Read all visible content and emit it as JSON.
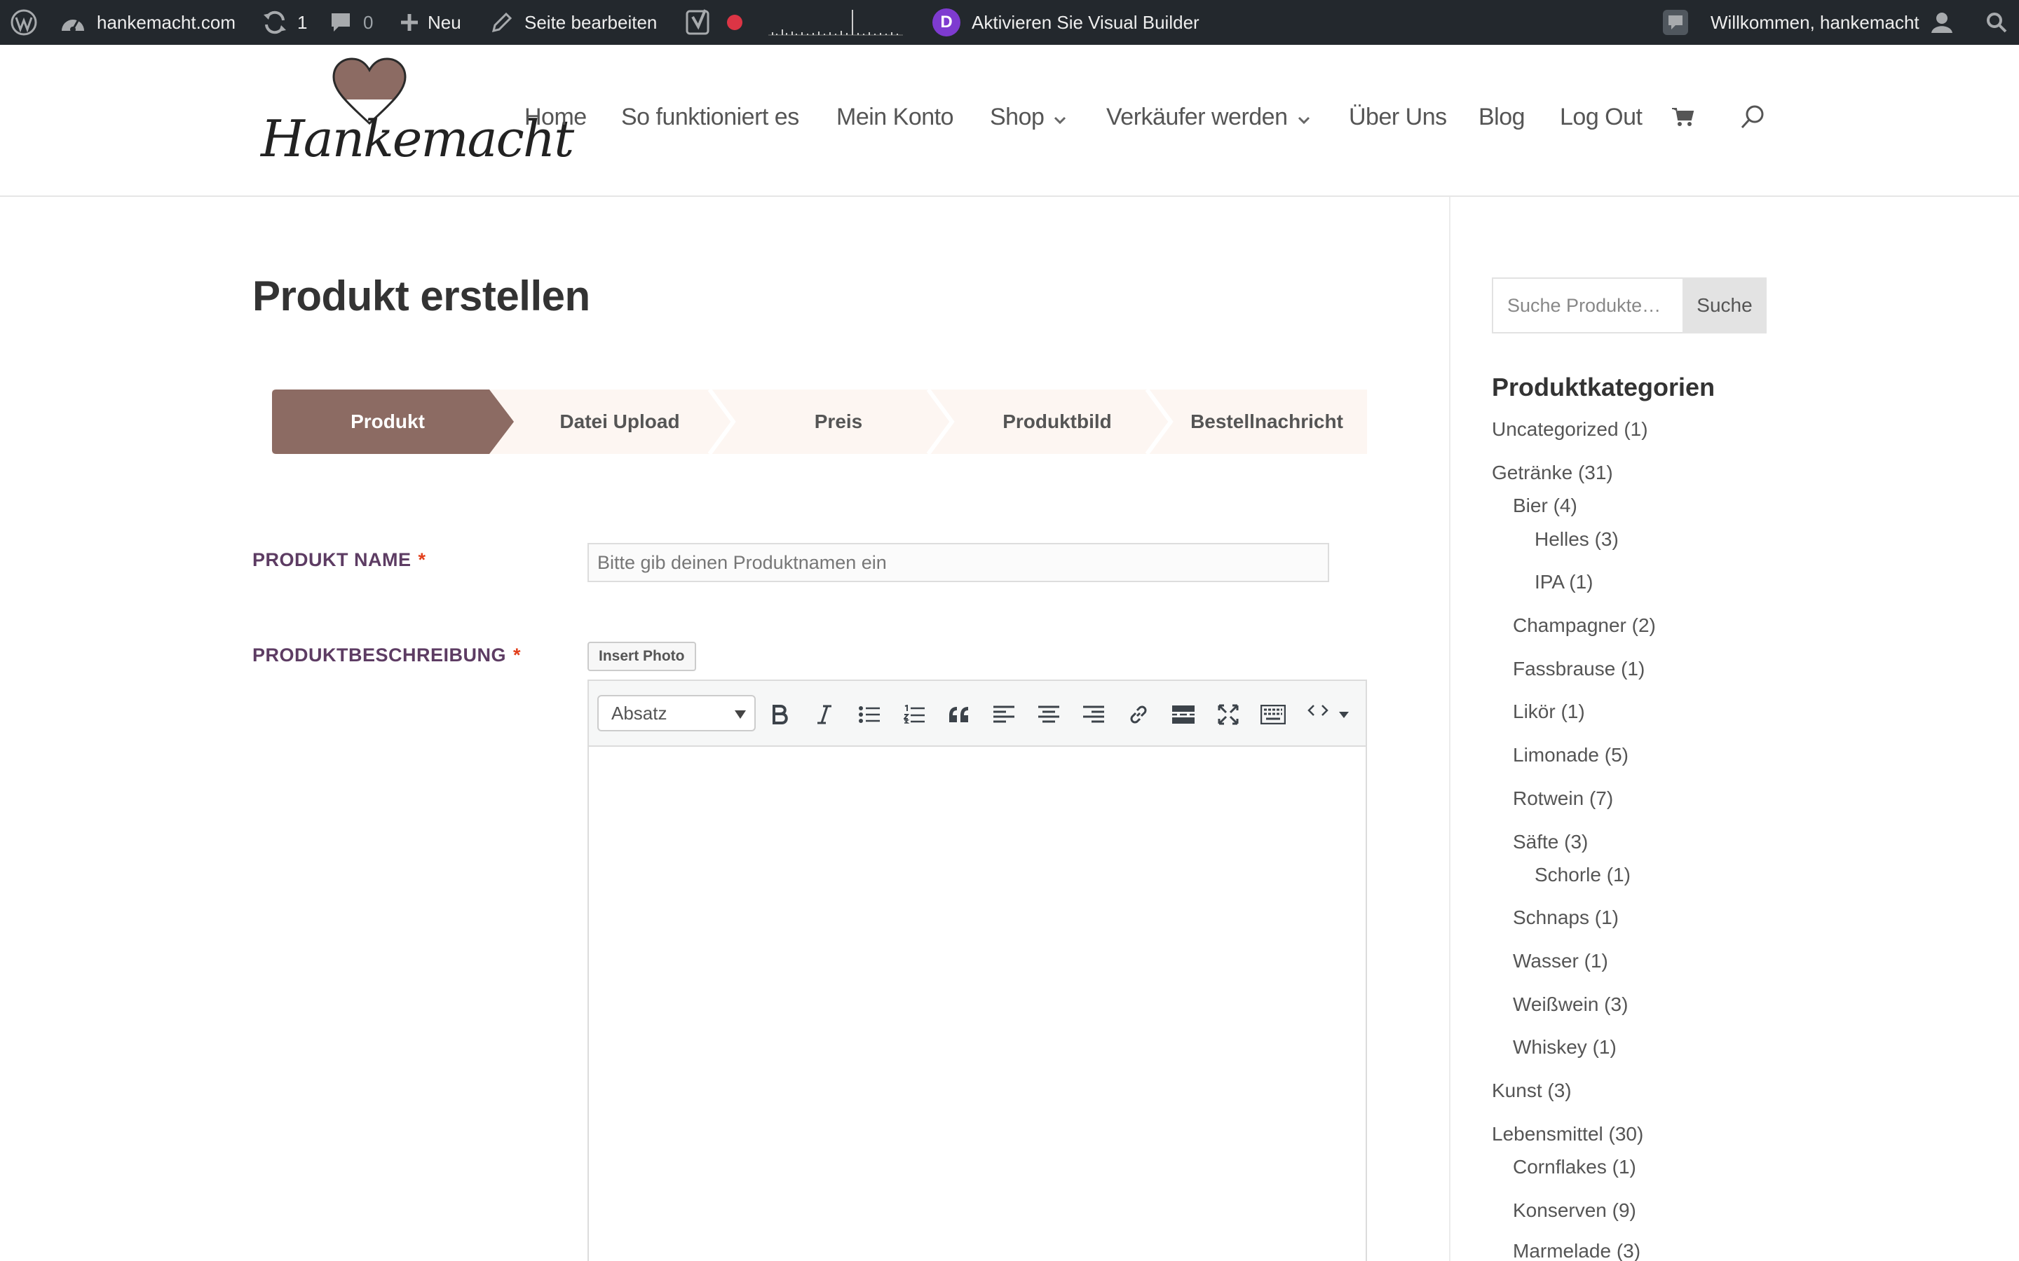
{
  "admin_bar": {
    "site_name": "hankemacht.com",
    "updates_count": "1",
    "comments_count": "0",
    "new_label": "Neu",
    "edit_label": "Seite bearbeiten",
    "visual_builder_badge": "D",
    "visual_builder_label": "Aktivieren Sie Visual Builder",
    "welcome_label": "Willkommen, hankemacht"
  },
  "header": {
    "logo_text": "Hankemacht",
    "nav": [
      {
        "label": "Home"
      },
      {
        "label": "So funktioniert es"
      },
      {
        "label": "Mein Konto"
      },
      {
        "label": "Shop"
      },
      {
        "label": "Verkäufer werden"
      },
      {
        "label": "Über Uns"
      },
      {
        "label": "Blog"
      },
      {
        "label": "Log Out"
      }
    ]
  },
  "page": {
    "title": "Produkt erstellen",
    "steps": [
      {
        "label": "Produkt",
        "active": true
      },
      {
        "label": "Datei Upload",
        "active": false
      },
      {
        "label": "Preis",
        "active": false
      },
      {
        "label": "Produktbild",
        "active": false
      },
      {
        "label": "Bestellnachricht",
        "active": false
      }
    ],
    "product_name_label": "PRODUKT NAME",
    "required_mark": "*",
    "product_name_placeholder": "Bitte gib deinen Produktnamen ein",
    "product_name_value": "",
    "description_label": "PRODUKTBESCHREIBUNG",
    "insert_photo_label": "Insert Photo",
    "format_select_value": "Absatz"
  },
  "sidebar": {
    "search_placeholder": "Suche Produkte…",
    "search_button": "Suche",
    "categories_heading": "Produktkategorien",
    "categories": [
      {
        "label": "Uncategorized (1)",
        "level": 0
      },
      {
        "label": "Getränke (31)",
        "level": 0
      },
      {
        "label": "Bier (4)",
        "level": 1
      },
      {
        "label": "Helles (3)",
        "level": 2
      },
      {
        "label": "IPA (1)",
        "level": 2
      },
      {
        "label": "Champagner (2)",
        "level": 1
      },
      {
        "label": "Fassbrause (1)",
        "level": 1
      },
      {
        "label": "Likör (1)",
        "level": 1
      },
      {
        "label": "Limonade (5)",
        "level": 1
      },
      {
        "label": "Rotwein (7)",
        "level": 1
      },
      {
        "label": "Säfte (3)",
        "level": 1
      },
      {
        "label": "Schorle (1)",
        "level": 2
      },
      {
        "label": "Schnaps (1)",
        "level": 1
      },
      {
        "label": "Wasser (1)",
        "level": 1
      },
      {
        "label": "Weißwein (3)",
        "level": 1
      },
      {
        "label": "Whiskey (1)",
        "level": 1
      },
      {
        "label": "Kunst (3)",
        "level": 0
      },
      {
        "label": "Lebensmittel (30)",
        "level": 0
      },
      {
        "label": "Cornflakes (1)",
        "level": 1
      },
      {
        "label": "Konserven (9)",
        "level": 1
      },
      {
        "label": "Marmelade (3)",
        "level": 1
      }
    ]
  },
  "colors": {
    "admin_bar_bg": "#23282d",
    "step_active": "#8c6b63",
    "step_inactive_bg": "#fdf6f2",
    "label_purple": "#5d3c63",
    "required_red": "#e2401c",
    "divi_purple": "#7e3bd0"
  }
}
